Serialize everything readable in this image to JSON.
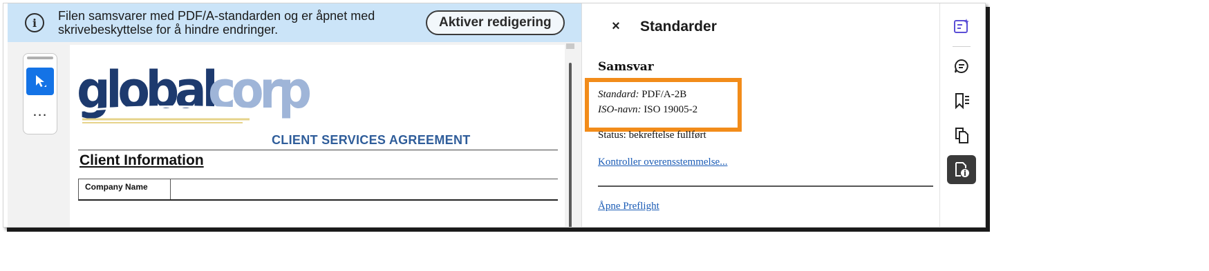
{
  "banner": {
    "line1": "Filen samsvarer med PDF/A-standarden og er åpnet med",
    "line2": "skrivebeskyttelse for å hindre endringer.",
    "enable_button": "Aktiver redigering"
  },
  "toolbar": {
    "more_label": "..."
  },
  "document": {
    "logo_part1": "global",
    "logo_part2": "corp",
    "agreement_title": "CLIENT SERVICES AGREEMENT",
    "section_heading": "Client Information",
    "table_first_header": "Company Name"
  },
  "panel": {
    "close_label": "×",
    "title": "Standarder",
    "conformance_heading": "Samsvar",
    "standard_label": "Standard:",
    "standard_value": "PDF/A-2B",
    "iso_label": "ISO-navn:",
    "iso_value": "ISO 19005-2",
    "status_text": "Status: bekreftelse fullført",
    "verify_link": "Kontroller overensstemmelse...",
    "preflight_link": "Åpne Preflight"
  },
  "colors": {
    "banner_bg": "#cbe4f8",
    "highlight_border": "#f28c1a",
    "link": "#1a5bb5",
    "select_tool_bg": "#1473e6",
    "rail_accent": "#5b4fd6"
  },
  "rail": {
    "icons": [
      "edit-sparkle-icon",
      "comment-icon",
      "bookmark-icon",
      "copy-pages-icon",
      "standards-info-icon"
    ]
  }
}
